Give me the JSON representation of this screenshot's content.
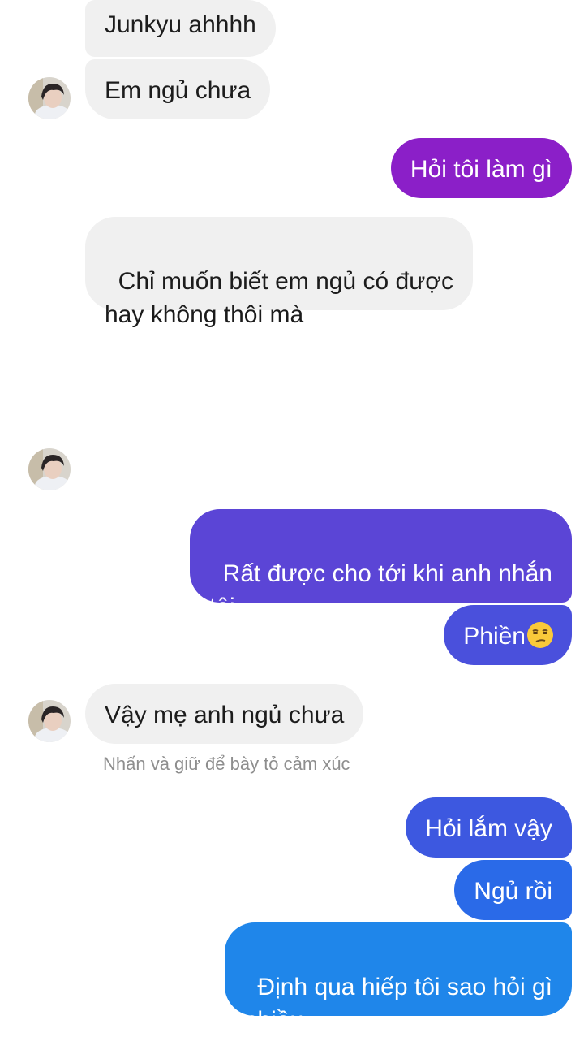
{
  "messages": [
    {
      "sender": "them",
      "text": "Junkyu ahhhh"
    },
    {
      "sender": "them",
      "text": "Em ngủ chưa"
    },
    {
      "sender": "me",
      "text": "Hỏi tôi làm gì"
    },
    {
      "sender": "them",
      "text": "Chỉ muốn biết em ngủ có được\nhay không thôi mà"
    },
    {
      "sender": "me",
      "text": "Rất được cho tới khi anh nhắn\ntôi"
    },
    {
      "sender": "me",
      "text": "Phiền",
      "emoji": "unamused-face"
    },
    {
      "sender": "them",
      "text": "Vậy mẹ anh ngủ chưa"
    },
    {
      "sender": "me",
      "text": "Hỏi lắm vậy"
    },
    {
      "sender": "me",
      "text": "Ngủ rồi"
    },
    {
      "sender": "me",
      "text": "Định qua hiếp tôi sao hỏi gì\nnhiều"
    }
  ],
  "reaction_hint": "Nhấn và giữ để bày tỏ cảm xúc",
  "colors": {
    "incoming_bubble": "#f0f0f0",
    "incoming_text": "#1c1c1c",
    "outgoing_text": "#ffffff",
    "hint_text": "#8e8e8e",
    "outgoing_gradient": [
      "#8b1fc8",
      "#5b45d6",
      "#3d58e0",
      "#2a6ae8",
      "#1f86ea"
    ]
  }
}
